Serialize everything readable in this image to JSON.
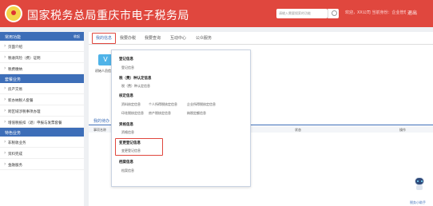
{
  "header": {
    "title": "国家税务总局重庆市电子税务局",
    "search_placeholder": "请输入需要搜索的功能",
    "user_info": "欢迎，XX公司 当前身份：企业管理员",
    "logout": "退出",
    "bg_color": "#e0473e"
  },
  "sidebar": {
    "sections": [
      {
        "label": "常用功能",
        "collapse": "收起",
        "items": [
          "页面介绍",
          "税收风险（费）证明",
          "税费缴纳"
        ]
      },
      {
        "label": "套餐业务",
        "items": [
          "房产交易",
          "新办纳税人套餐",
          "跨区域涉税事项办理",
          "增值税抵扣（退）申报与发票套餐"
        ]
      },
      {
        "label": "特色业务",
        "items": [
          "非税收业务",
          "资料完成",
          "金融服务"
        ]
      }
    ]
  },
  "tabs": [
    "我的信息",
    "我要办税",
    "我要查询",
    "互动中心",
    "公众服务"
  ],
  "quick": {
    "icon": "V",
    "label": "初始人员信息"
  },
  "subtab": "我的待办",
  "table_headers": [
    "事项名称",
    "状态",
    "操作"
  ],
  "dropdown": {
    "groups": [
      {
        "head": "登记信息",
        "items": [
          "登记信息"
        ]
      },
      {
        "head": "税（费）种认定信息",
        "items": [
          "税（费）种认定信息"
        ]
      },
      {
        "head": "核定信息",
        "items": [
          "资料核定信息",
          "个人所得税核定信息",
          "企业所得税核定信息",
          "印花税核定信息",
          "房产税核定信息",
          "纳税定额信息"
        ]
      },
      {
        "head": "资格信息",
        "items": [
          "资格信息"
        ]
      },
      {
        "head": "变更登记信息",
        "items": [
          "变更登记信息"
        ]
      },
      {
        "head": "档案信息",
        "items": [
          "档案信息"
        ]
      }
    ]
  },
  "robot_label": "税务小助手"
}
